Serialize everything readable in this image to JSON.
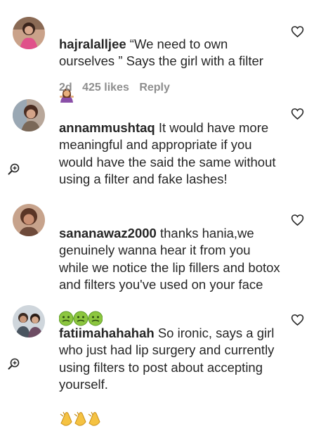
{
  "comments": [
    {
      "username": "hajralalljee",
      "text": " “We need to own ourselves ” Says the girl with a filter",
      "emoji": "woman-shrugging-emoji",
      "time": "2d",
      "likes": "425 likes",
      "reply": "Reply",
      "avatar": "avatar-woman-pink",
      "like_icon": "heart-outline-icon"
    },
    {
      "username": "annammushtaq",
      "text": " It would have more meaningful and appropriate if you would have the said the same without using a filter and fake lashes!",
      "avatar": "avatar-woman-brown",
      "like_icon": "heart-outline-icon",
      "zoom_icon": "zoom-in-icon"
    },
    {
      "username": "sananawaz2000",
      "text": " thanks hania,we genuinely wanna hear it from you while we notice the lip fillers and botox and filters you've used on your face",
      "emoji": "nauseated-face-emoji x3",
      "avatar": "avatar-woman-dark",
      "like_icon": "heart-outline-icon"
    },
    {
      "username": "fatiimahahahah",
      "text": " So ironic, says a girl who just had lip surgery and currently using filters to post about accepting yourself.",
      "emoji": "clapping-hands-emoji x3",
      "avatar": "avatar-couple",
      "like_icon": "heart-outline-icon",
      "zoom_icon": "zoom-in-icon"
    }
  ],
  "colors": {
    "text": "#262626",
    "meta": "#8e8e8e",
    "icon": "#262626"
  }
}
